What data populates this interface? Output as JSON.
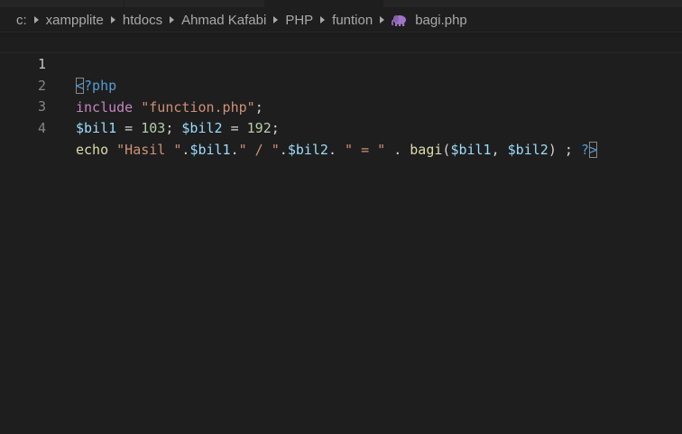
{
  "breadcrumb": {
    "items": [
      {
        "label": "c:"
      },
      {
        "label": "xampplite"
      },
      {
        "label": "htdocs"
      },
      {
        "label": "Ahmad Kafabi"
      },
      {
        "label": "PHP"
      },
      {
        "label": "funtion"
      }
    ],
    "file": {
      "label": "bagi.php",
      "icon": "php-elephant-icon"
    }
  },
  "editor": {
    "active_line": 1,
    "lines": [
      {
        "number": "1"
      },
      {
        "number": "2"
      },
      {
        "number": "3"
      },
      {
        "number": "4"
      }
    ],
    "tokens": {
      "l1_open_bracket": "<",
      "l1_rest": "?php",
      "l2_kw": "include",
      "l2_str": "\"function.php\"",
      "l2_end": ";",
      "l3_var1": "$bil1",
      "l3_eq1": " = ",
      "l3_num1": "103",
      "l3_semi1": "; ",
      "l3_var2": "$bil2",
      "l3_eq2": " = ",
      "l3_num2": "192",
      "l3_semi2": ";",
      "l4_echo": "echo",
      "l4_sp1": " ",
      "l4_str1": "\"Hasil \"",
      "l4_dot1": ".",
      "l4_var1": "$bil1",
      "l4_dot2": ".",
      "l4_str2": "\" / \"",
      "l4_dot3": ".",
      "l4_var2": "$bil2",
      "l4_dot4": ". ",
      "l4_str3": "\" = \"",
      "l4_dot5": " . ",
      "l4_fn": "bagi",
      "l4_paren_open": "(",
      "l4_arg1": "$bil1",
      "l4_comma": ", ",
      "l4_arg2": "$bil2",
      "l4_paren_close": ") ; ",
      "l4_close_q": "?",
      "l4_close_bracket": ">"
    }
  },
  "colors": {
    "background": "#1e1e1e",
    "keyword": "#c586c0",
    "tag": "#569cd6",
    "variable": "#9cdcfe",
    "string": "#ce9178",
    "number": "#b5cea8",
    "function": "#dcdcaa",
    "php_icon": "#a074c4"
  }
}
